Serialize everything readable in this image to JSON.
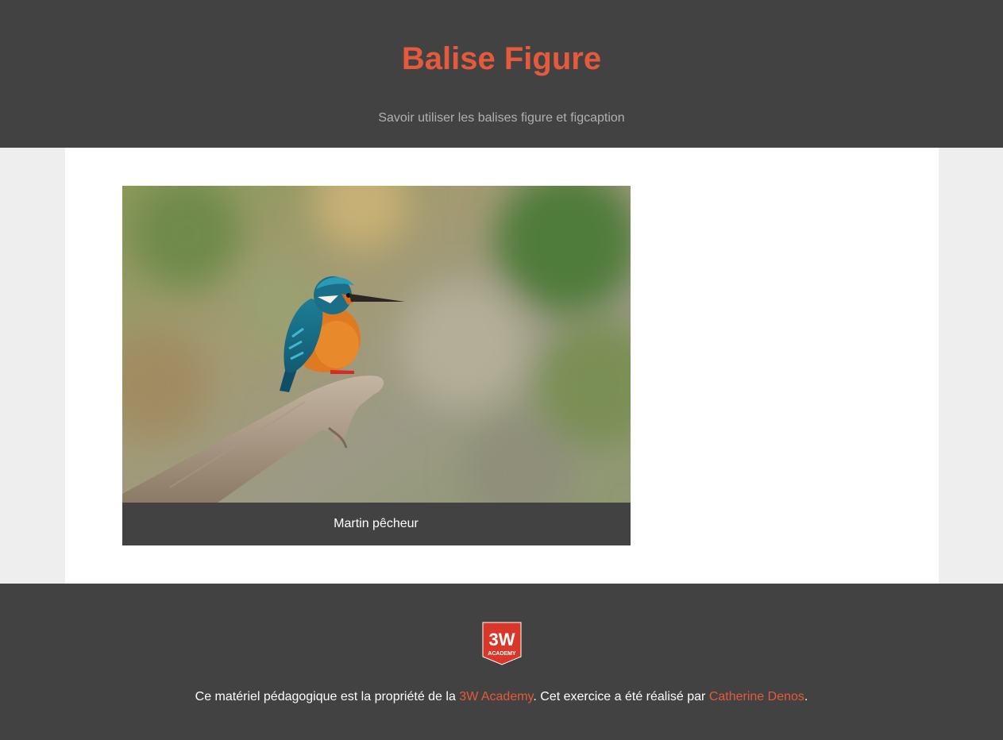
{
  "header": {
    "title": "Balise Figure",
    "subtitle": "Savoir utiliser les balises figure et figcaption"
  },
  "figure": {
    "image_icon": "kingfisher-photo",
    "caption": "Martin pêcheur"
  },
  "footer": {
    "logo_text": "3W",
    "logo_subtext": "ACADEMY",
    "text_before": "Ce matériel pédagogique est la propriété de la ",
    "link_academy": "3W Academy",
    "text_middle": ". Cet exercice a été réalisé par ",
    "link_author": "Catherine Denos",
    "text_after": "."
  },
  "colors": {
    "accent": "#e55a3c",
    "dark": "#424242",
    "page_bg": "#eeeeee"
  }
}
